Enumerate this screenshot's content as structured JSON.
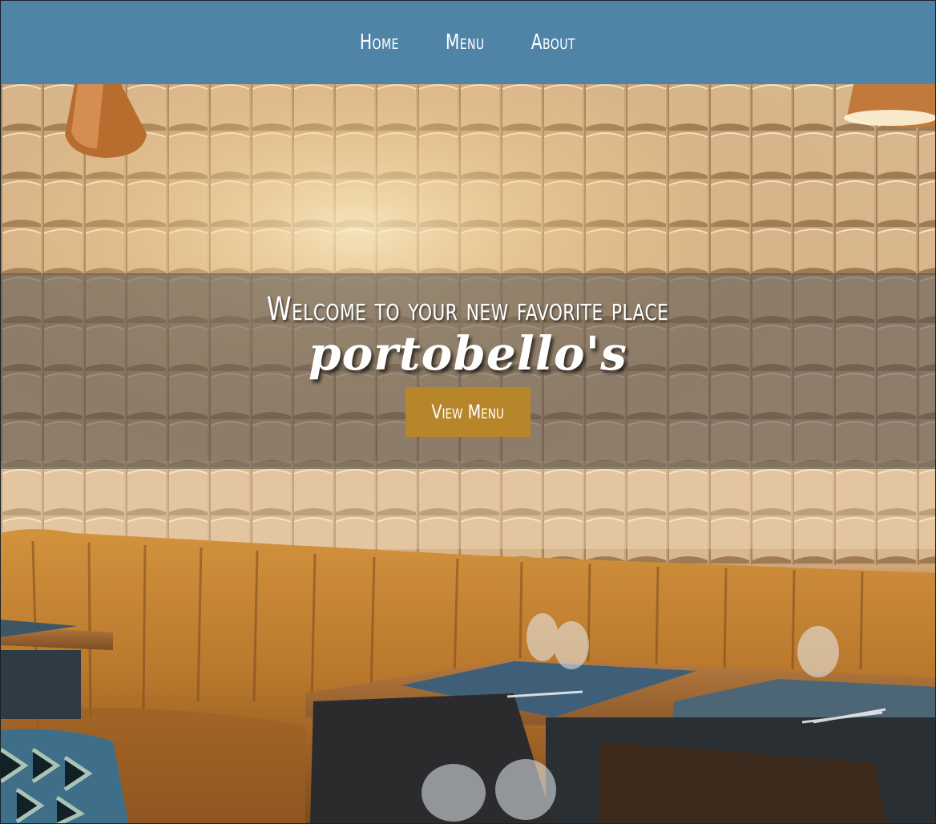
{
  "nav": {
    "items": [
      {
        "label": "Home"
      },
      {
        "label": "Menu"
      },
      {
        "label": "About"
      }
    ]
  },
  "hero": {
    "welcome": "Welcome to your new favorite place",
    "brand": "portobello's",
    "button_label": "View Menu"
  },
  "colors": {
    "nav_background": "#4f84a7",
    "button_background": "#b8862a",
    "band_overlay": "rgba(80,78,78,0.55)"
  }
}
